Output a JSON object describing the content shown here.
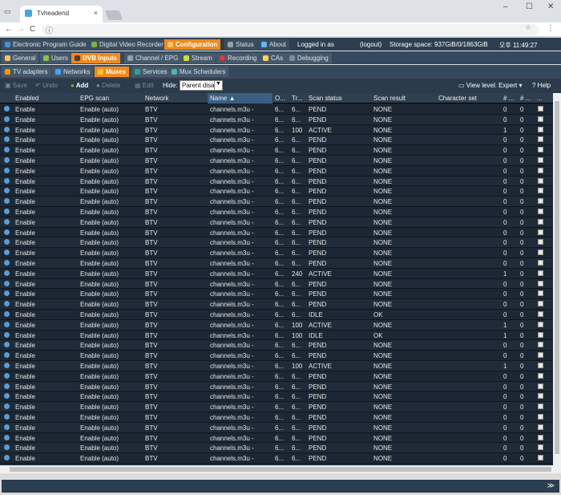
{
  "browser": {
    "tab_title": "Tvheadend",
    "tab_close": "×",
    "win_min": "–",
    "win_max": "☐",
    "win_close": "✕",
    "back": "←",
    "forward": "→",
    "reload": "C",
    "info": "ⓘ",
    "star": "☆",
    "menu": "⋮"
  },
  "top_tabs": [
    {
      "label": "Electronic Program Guide",
      "color": "#4a90d9"
    },
    {
      "label": "Digital Video Recorder",
      "color": "#7cb342"
    },
    {
      "label": "Configuration",
      "color": "#f5c26b"
    },
    {
      "label": "Status",
      "color": "#90a4ae"
    },
    {
      "label": "About",
      "color": "#64b5f6"
    }
  ],
  "login": {
    "text": "Logged in as",
    "logout": "(logout)",
    "storage": "Storage space: 937GiB/0/1863GiB",
    "time": "오후 11:49:27"
  },
  "config_tabs": [
    {
      "label": "General"
    },
    {
      "label": "Users"
    },
    {
      "label": "DVB Inputs"
    },
    {
      "label": "Channel / EPG"
    },
    {
      "label": "Stream"
    },
    {
      "label": "Recording"
    },
    {
      "label": "CAs"
    },
    {
      "label": "Debugging"
    }
  ],
  "dvb_tabs": [
    {
      "label": "TV adapters"
    },
    {
      "label": "Networks"
    },
    {
      "label": "Muxes"
    },
    {
      "label": "Services"
    },
    {
      "label": "Mux Schedulers"
    }
  ],
  "toolbar": {
    "save": "Save",
    "undo": "Undo",
    "add": "Add",
    "delete": "Delete",
    "edit": "Edit",
    "hide_label": "Hide:",
    "hide_value": "Parent disa",
    "view_level": "View level: Expert",
    "help": "Help"
  },
  "columns": [
    "Enabled",
    "EPG scan",
    "Network",
    "Name ▲",
    "O...",
    "Tr...",
    "Scan status",
    "Scan result",
    "Character set",
    "# ...",
    "# ...",
    "..."
  ],
  "rows": [
    [
      "Enable",
      "Enable (auto)",
      "BTV",
      "channels.m3u -",
      "6...",
      "6...",
      "PEND",
      "NONE",
      "",
      "0",
      "0"
    ],
    [
      "Enable",
      "Enable (auto)",
      "BTV",
      "channels.m3u -",
      "6...",
      "6...",
      "PEND",
      "NONE",
      "",
      "0",
      "0"
    ],
    [
      "Enable",
      "Enable (auto)",
      "BTV",
      "channels.m3u -",
      "6...",
      "100",
      "ACTIVE",
      "NONE",
      "",
      "1",
      "0"
    ],
    [
      "Enable",
      "Enable (auto)",
      "BTV",
      "channels.m3u -",
      "6...",
      "6...",
      "PEND",
      "NONE",
      "",
      "0",
      "0"
    ],
    [
      "Enable",
      "Enable (auto)",
      "BTV",
      "channels.m3u -",
      "6...",
      "6...",
      "PEND",
      "NONE",
      "",
      "0",
      "0"
    ],
    [
      "Enable",
      "Enable (auto)",
      "BTV",
      "channels.m3u -",
      "6...",
      "6...",
      "PEND",
      "NONE",
      "",
      "0",
      "0"
    ],
    [
      "Enable",
      "Enable (auto)",
      "BTV",
      "channels.m3u -",
      "6...",
      "6...",
      "PEND",
      "NONE",
      "",
      "0",
      "0"
    ],
    [
      "Enable",
      "Enable (auto)",
      "BTV",
      "channels.m3u -",
      "6...",
      "6...",
      "PEND",
      "NONE",
      "",
      "0",
      "0"
    ],
    [
      "Enable",
      "Enable (auto)",
      "BTV",
      "channels.m3u -",
      "6...",
      "6...",
      "PEND",
      "NONE",
      "",
      "0",
      "0"
    ],
    [
      "Enable",
      "Enable (auto)",
      "BTV",
      "channels.m3u -",
      "6...",
      "6...",
      "PEND",
      "NONE",
      "",
      "0",
      "0"
    ],
    [
      "Enable",
      "Enable (auto)",
      "BTV",
      "channels.m3u -",
      "6...",
      "6...",
      "PEND",
      "NONE",
      "",
      "0",
      "0"
    ],
    [
      "Enable",
      "Enable (auto)",
      "BTV",
      "channels.m3u -",
      "6...",
      "6...",
      "PEND",
      "NONE",
      "",
      "0",
      "0"
    ],
    [
      "Enable",
      "Enable (auto)",
      "BTV",
      "channels.m3u -",
      "6...",
      "6...",
      "PEND",
      "NONE",
      "",
      "0",
      "0"
    ],
    [
      "Enable",
      "Enable (auto)",
      "BTV",
      "channels.m3u -",
      "6...",
      "6...",
      "PEND",
      "NONE",
      "",
      "0",
      "0"
    ],
    [
      "Enable",
      "Enable (auto)",
      "BTV",
      "channels.m3u -",
      "6...",
      "6...",
      "PEND",
      "NONE",
      "",
      "0",
      "0"
    ],
    [
      "Enable",
      "Enable (auto)",
      "BTV",
      "channels.m3u -",
      "6...",
      "6...",
      "PEND",
      "NONE",
      "",
      "0",
      "0"
    ],
    [
      "Enable",
      "Enable (auto)",
      "BTV",
      "channels.m3u -",
      "6...",
      "240",
      "ACTIVE",
      "NONE",
      "",
      "1",
      "0"
    ],
    [
      "Enable",
      "Enable (auto)",
      "BTV",
      "channels.m3u -",
      "6...",
      "6...",
      "PEND",
      "NONE",
      "",
      "0",
      "0"
    ],
    [
      "Enable",
      "Enable (auto)",
      "BTV",
      "channels.m3u -",
      "6...",
      "6...",
      "PEND",
      "NONE",
      "",
      "0",
      "0"
    ],
    [
      "Enable",
      "Enable (auto)",
      "BTV",
      "channels.m3u -",
      "6...",
      "6...",
      "PEND",
      "NONE",
      "",
      "0",
      "0"
    ],
    [
      "Enable",
      "Enable (auto)",
      "BTV",
      "channels.m3u -",
      "6...",
      "6...",
      "IDLE",
      "OK",
      "",
      "0",
      "0"
    ],
    [
      "Enable",
      "Enable (auto)",
      "BTV",
      "channels.m3u -",
      "6...",
      "100",
      "ACTIVE",
      "NONE",
      "",
      "1",
      "0"
    ],
    [
      "Enable",
      "Enable (auto)",
      "BTV",
      "channels.m3u -",
      "6...",
      "100",
      "IDLE",
      "OK",
      "",
      "1",
      "0"
    ],
    [
      "Enable",
      "Enable (auto)",
      "BTV",
      "channels.m3u -",
      "6...",
      "6...",
      "PEND",
      "NONE",
      "",
      "0",
      "0"
    ],
    [
      "Enable",
      "Enable (auto)",
      "BTV",
      "channels.m3u -",
      "6...",
      "6...",
      "PEND",
      "NONE",
      "",
      "0",
      "0"
    ],
    [
      "Enable",
      "Enable (auto)",
      "BTV",
      "channels.m3u -",
      "6...",
      "100",
      "ACTIVE",
      "NONE",
      "",
      "1",
      "0"
    ],
    [
      "Enable",
      "Enable (auto)",
      "BTV",
      "channels.m3u -",
      "6...",
      "6...",
      "PEND",
      "NONE",
      "",
      "0",
      "0"
    ],
    [
      "Enable",
      "Enable (auto)",
      "BTV",
      "channels.m3u -",
      "6...",
      "6...",
      "PEND",
      "NONE",
      "",
      "0",
      "0"
    ],
    [
      "Enable",
      "Enable (auto)",
      "BTV",
      "channels.m3u -",
      "6...",
      "6...",
      "PEND",
      "NONE",
      "",
      "0",
      "0"
    ],
    [
      "Enable",
      "Enable (auto)",
      "BTV",
      "channels.m3u -",
      "6...",
      "6...",
      "PEND",
      "NONE",
      "",
      "0",
      "0"
    ],
    [
      "Enable",
      "Enable (auto)",
      "BTV",
      "channels.m3u -",
      "6...",
      "6...",
      "PEND",
      "NONE",
      "",
      "0",
      "0"
    ],
    [
      "Enable",
      "Enable (auto)",
      "BTV",
      "channels.m3u -",
      "6...",
      "6...",
      "PEND",
      "NONE",
      "",
      "0",
      "0"
    ],
    [
      "Enable",
      "Enable (auto)",
      "BTV",
      "channels.m3u -",
      "6...",
      "6...",
      "PEND",
      "NONE",
      "",
      "0",
      "0"
    ],
    [
      "Enable",
      "Enable (auto)",
      "BTV",
      "channels.m3u -",
      "6...",
      "6...",
      "PEND",
      "NONE",
      "",
      "0",
      "0"
    ],
    [
      "Enable",
      "Enable (auto)",
      "BTV",
      "channels.m3u -",
      "6...",
      "6...",
      "PEND",
      "NONE",
      "",
      "0",
      "0"
    ],
    [
      "Enable",
      "Enable (auto)",
      "BTV",
      "channels.m3u -",
      "6...",
      "6...",
      "PEND",
      "NONE",
      "",
      "0",
      "0"
    ]
  ],
  "bottom": {
    "collapse": "≫"
  }
}
